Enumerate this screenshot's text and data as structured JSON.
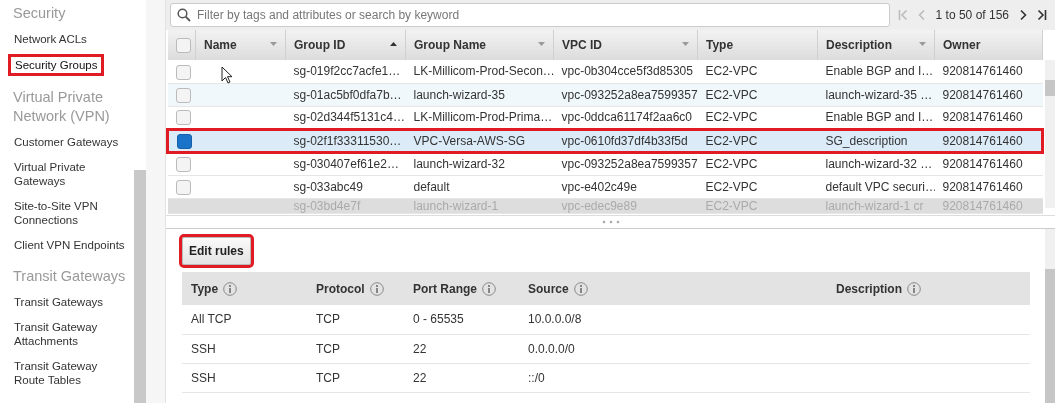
{
  "sidebar": {
    "sections": [
      {
        "heading": "Security",
        "items": [
          {
            "label": "Network ACLs",
            "selected": false,
            "annotated": false
          },
          {
            "label": "Security Groups",
            "selected": true,
            "annotated": true
          }
        ]
      },
      {
        "heading": "Virtual Private Network (VPN)",
        "items": [
          {
            "label": "Customer Gateways",
            "selected": false,
            "annotated": false
          },
          {
            "label": "Virtual Private Gateways",
            "selected": false,
            "annotated": false
          },
          {
            "label": "Site-to-Site VPN Connections",
            "selected": false,
            "annotated": false
          },
          {
            "label": "Client VPN Endpoints",
            "selected": false,
            "annotated": false
          }
        ]
      },
      {
        "heading": "Transit Gateways",
        "items": [
          {
            "label": "Transit Gateways",
            "selected": false,
            "annotated": false
          },
          {
            "label": "Transit Gateway Attachments",
            "selected": false,
            "annotated": false
          },
          {
            "label": "Transit Gateway Route Tables",
            "selected": false,
            "annotated": false
          }
        ]
      }
    ]
  },
  "search": {
    "placeholder": "Filter by tags and attributes or search by keyword"
  },
  "pagination": {
    "summary": "1 to 50 of 156",
    "first_disabled": true,
    "prev_disabled": true,
    "next_disabled": false,
    "last_disabled": false
  },
  "table": {
    "select_all": {
      "checked": false
    },
    "columns": [
      {
        "label": "Name",
        "has_menu": true,
        "sorted": false
      },
      {
        "label": "Group ID",
        "has_menu": false,
        "sorted": true
      },
      {
        "label": "Group Name",
        "has_menu": true,
        "sorted": false
      },
      {
        "label": "VPC ID",
        "has_menu": true,
        "sorted": false
      },
      {
        "label": "Type",
        "has_menu": false,
        "sorted": false
      },
      {
        "label": "Description",
        "has_menu": true,
        "sorted": false
      },
      {
        "label": "Owner",
        "has_menu": false,
        "sorted": false
      }
    ],
    "rows": [
      {
        "cells": [
          "",
          "sg-019f2cc7acfe1…",
          "LK-Millicom-Prod-Secon…",
          "vpc-0b304cce5f3d85305",
          "EC2-VPC",
          "Enable BGP and I…",
          "920814761460"
        ],
        "selected": false,
        "hovered": false,
        "annotated": false,
        "partial": false
      },
      {
        "cells": [
          "",
          "sg-01ac5bf0dfa7b…",
          "launch-wizard-35",
          "vpc-093252a8ea7599357",
          "EC2-VPC",
          "launch-wizard-35 …",
          "920814761460"
        ],
        "selected": false,
        "hovered": true,
        "annotated": false,
        "partial": false
      },
      {
        "cells": [
          "",
          "sg-02d344f5131c4…",
          "LK-Millicom-Prod-Prima…",
          "vpc-0ddca61174f2aa6c0",
          "EC2-VPC",
          "Enable BGP and I…",
          "920814761460"
        ],
        "selected": false,
        "hovered": false,
        "annotated": false,
        "partial": false
      },
      {
        "cells": [
          "",
          "sg-02f1f33311530…",
          "VPC-Versa-AWS-SG",
          "vpc-0610fd37df4b33f5d",
          "EC2-VPC",
          "SG_description",
          "920814761460"
        ],
        "selected": true,
        "hovered": false,
        "annotated": true,
        "partial": false
      },
      {
        "cells": [
          "",
          "sg-030407ef61e2…",
          "launch-wizard-32",
          "vpc-093252a8ea7599357",
          "EC2-VPC",
          "launch-wizard-32 …",
          "920814761460"
        ],
        "selected": false,
        "hovered": false,
        "annotated": false,
        "partial": false
      },
      {
        "cells": [
          "",
          "sg-033abc49",
          "default",
          "vpc-e402c49e",
          "EC2-VPC",
          "default VPC securi…",
          "920814761460"
        ],
        "selected": false,
        "hovered": false,
        "annotated": false,
        "partial": false
      },
      {
        "cells": [
          "",
          "sg-03bd4e7f",
          "launch-wizard-1",
          "vpc-edec9e89",
          "EC2-VPC",
          "launch-wizard-1 cr",
          "920814761460"
        ],
        "selected": false,
        "hovered": false,
        "annotated": false,
        "partial": true
      }
    ]
  },
  "edit_button": {
    "label": "Edit rules",
    "annotated": true
  },
  "rules": {
    "columns": [
      "Type",
      "Protocol",
      "Port Range",
      "Source",
      "Description"
    ],
    "rows": [
      [
        "All TCP",
        "TCP",
        "0 - 65535",
        "10.0.0.0/8",
        ""
      ],
      [
        "SSH",
        "TCP",
        "22",
        "0.0.0.0/0",
        ""
      ],
      [
        "SSH",
        "TCP",
        "22",
        "::/0",
        ""
      ]
    ]
  }
}
